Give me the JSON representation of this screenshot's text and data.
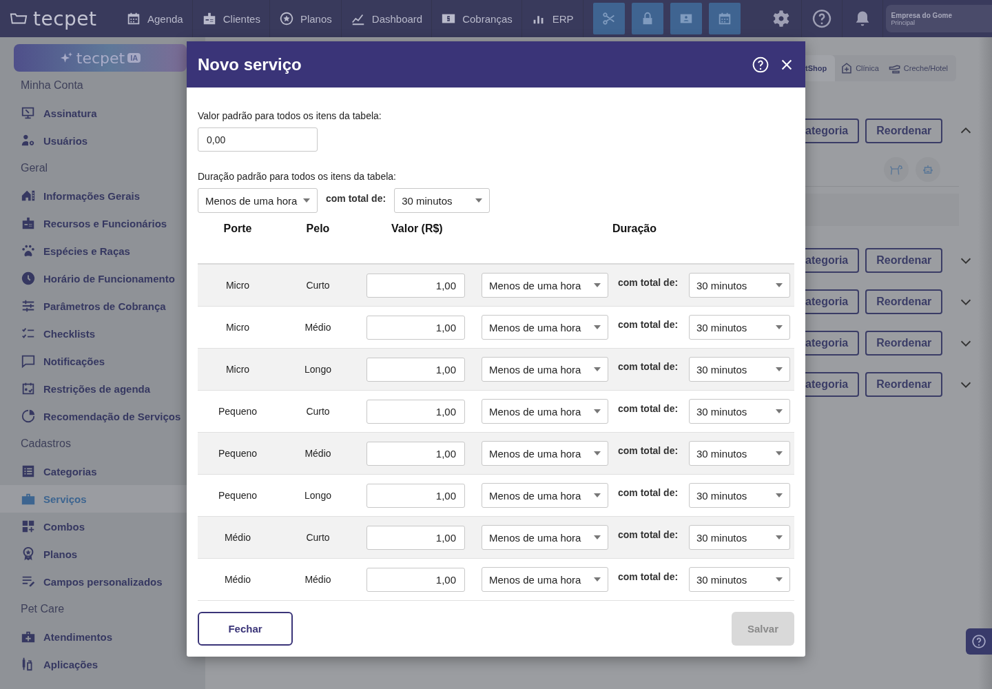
{
  "top_bar": {
    "logo": "tecpet",
    "nav": [
      {
        "label": "Agenda"
      },
      {
        "label": "Clientes"
      },
      {
        "label": "Planos"
      },
      {
        "label": "Dashboard"
      },
      {
        "label": "Cobranças"
      },
      {
        "label": "ERP"
      }
    ],
    "company": {
      "name": "Empresa do Gome",
      "subtitle": "Principal"
    }
  },
  "sidebar": {
    "ai_button": {
      "label": "tecpet",
      "badge": "IA"
    },
    "sections": [
      {
        "title": "Minha Conta",
        "items": [
          {
            "label": "Assinatura",
            "selected": false
          },
          {
            "label": "Usuários",
            "selected": false
          }
        ]
      },
      {
        "title": "Geral",
        "items": [
          {
            "label": "Informações Gerais",
            "selected": false
          },
          {
            "label": "Recursos e Funcionários",
            "selected": false
          },
          {
            "label": "Espécies e Raças",
            "selected": false
          },
          {
            "label": "Horário de Funcionamento",
            "selected": false
          },
          {
            "label": "Parâmetros de Cobrança",
            "selected": false
          },
          {
            "label": "Checklists",
            "selected": false
          },
          {
            "label": "Notificações",
            "selected": false
          },
          {
            "label": "Restrições de agenda",
            "selected": false
          },
          {
            "label": "Recomendação de Serviços",
            "selected": false
          }
        ]
      },
      {
        "title": "Cadastros",
        "items": [
          {
            "label": "Categorias",
            "selected": false
          },
          {
            "label": "Serviços",
            "selected": true
          },
          {
            "label": "Combos",
            "selected": false
          },
          {
            "label": "Planos",
            "selected": false
          },
          {
            "label": "Campos personalizados",
            "selected": false
          }
        ]
      },
      {
        "title": "Pet Care",
        "items": [
          {
            "label": "Atendimentos",
            "selected": false
          },
          {
            "label": "Aplicações",
            "selected": false
          }
        ]
      }
    ]
  },
  "background_panel": {
    "tabs": [
      {
        "label": "tShop",
        "selected": true
      },
      {
        "label": "Clínica",
        "selected": false
      },
      {
        "label": "Creche/Hotel",
        "selected": false
      }
    ],
    "groups": [
      {
        "category_button": "ategoria",
        "reorder_button": "Reordenar",
        "expanded": true
      },
      {
        "category_button": "ategoria",
        "reorder_button": "Reordenar",
        "expanded": false
      },
      {
        "category_button": "ategoria",
        "reorder_button": "Reordenar",
        "expanded": false
      },
      {
        "category_button": "ategoria",
        "reorder_button": "Reordenar",
        "expanded": false
      },
      {
        "category_button": "ategoria",
        "reorder_button": "Reordenar",
        "expanded": false
      }
    ]
  },
  "modal": {
    "title": "Novo serviço",
    "default_value": {
      "label": "Valor padrão para todos os itens da tabela:",
      "value": "0,00"
    },
    "default_duration": {
      "label": "Duração padrão para todos os itens da tabela:",
      "value": "Menos de uma hora",
      "total_label": "com total de:",
      "total": "30 minutos"
    },
    "table": {
      "columns": [
        "Porte",
        "Pelo",
        "Valor (R$)",
        "Duração"
      ],
      "rows": [
        {
          "porte": "Micro",
          "pelo": "Curto",
          "valor": "1,00",
          "duracao": "Menos de uma hora",
          "total_label": "com total de:",
          "total": "30 minutos"
        },
        {
          "porte": "Micro",
          "pelo": "Médio",
          "valor": "1,00",
          "duracao": "Menos de uma hora",
          "total_label": "com total de:",
          "total": "30 minutos"
        },
        {
          "porte": "Micro",
          "pelo": "Longo",
          "valor": "1,00",
          "duracao": "Menos de uma hora",
          "total_label": "com total de:",
          "total": "30 minutos"
        },
        {
          "porte": "Pequeno",
          "pelo": "Curto",
          "valor": "1,00",
          "duracao": "Menos de uma hora",
          "total_label": "com total de:",
          "total": "30 minutos"
        },
        {
          "porte": "Pequeno",
          "pelo": "Médio",
          "valor": "1,00",
          "duracao": "Menos de uma hora",
          "total_label": "com total de:",
          "total": "30 minutos"
        },
        {
          "porte": "Pequeno",
          "pelo": "Longo",
          "valor": "1,00",
          "duracao": "Menos de uma hora",
          "total_label": "com total de:",
          "total": "30 minutos"
        },
        {
          "porte": "Médio",
          "pelo": "Curto",
          "valor": "1,00",
          "duracao": "Menos de uma hora",
          "total_label": "com total de:",
          "total": "30 minutos"
        },
        {
          "porte": "Médio",
          "pelo": "Médio",
          "valor": "1,00",
          "duracao": "Menos de uma hora",
          "total_label": "com total de:",
          "total": "30 minutos"
        }
      ]
    },
    "close_button": "Fechar",
    "save_button": {
      "label": "Salvar",
      "disabled": true
    }
  }
}
